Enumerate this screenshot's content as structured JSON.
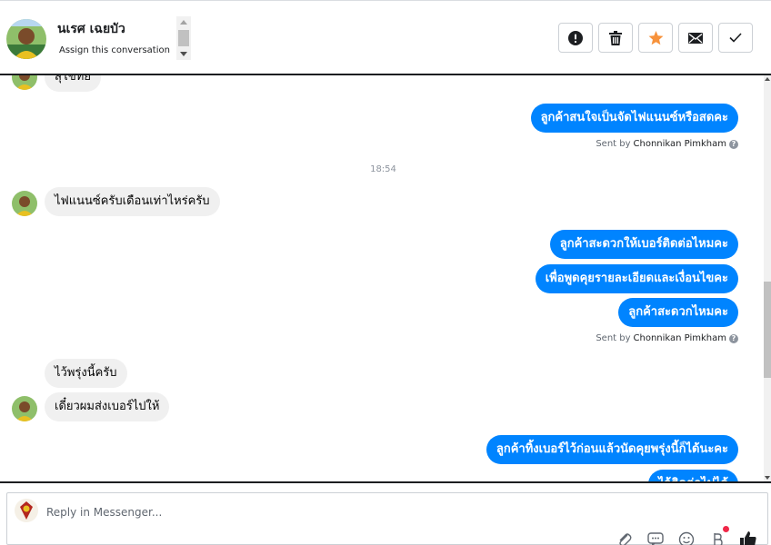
{
  "header": {
    "contact_name": "นเรศ เฉยบัว",
    "assign_label": "Assign this conversation",
    "actions": [
      {
        "name": "mark-spam-button",
        "icon": "exclamation-icon"
      },
      {
        "name": "delete-button",
        "icon": "trash-icon"
      },
      {
        "name": "star-button",
        "icon": "star-icon",
        "color": "#f7923b"
      },
      {
        "name": "mark-unread-button",
        "icon": "envelope-icon"
      },
      {
        "name": "mark-done-button",
        "icon": "check-icon"
      }
    ]
  },
  "conversation": {
    "messages": [
      {
        "dir": "in",
        "text": "สุโขทัย"
      },
      {
        "dir": "out",
        "text": "ลูกค้าสนใจเป็นจัดไฟแนนซ์หรือสดคะ"
      },
      {
        "type": "sent_by",
        "prefix": "Sent by",
        "name": "Chonnikan Pimkham"
      },
      {
        "type": "time",
        "text": "18:54"
      },
      {
        "dir": "in",
        "text": "ไฟแนนซ์ครับเดือนเท่าไหร่ครับ"
      },
      {
        "dir": "out",
        "text": "ลูกค้าสะดวกให้เบอร์ติดต่อไหมคะ"
      },
      {
        "dir": "out",
        "text": "เพื่อพูดคุยรายละเอียดและเงื่อนไขคะ"
      },
      {
        "dir": "out",
        "text": "ลูกค้าสะดวกไหมคะ"
      },
      {
        "type": "sent_by",
        "prefix": "Sent by",
        "name": "Chonnikan Pimkham"
      },
      {
        "dir": "in",
        "text": "ไว้พรุ่งนี้ครับ"
      },
      {
        "dir": "in",
        "text": "เดี๋ยวผมส่งเบอร์ไปให้"
      },
      {
        "dir": "out",
        "text": "ลูกค้าทิ้งเบอร์ไว้ก่อนแล้วนัดคุยพรุ่งนี้ก็ได้นะคะ"
      },
      {
        "dir": "out",
        "text": "ไว้ติดต่อไปได้"
      }
    ]
  },
  "composer": {
    "placeholder": "Reply in Messenger...",
    "tools": [
      "paperclip-icon",
      "saved-reply-icon",
      "emoji-icon",
      "currency-icon",
      "thumbs-up-icon"
    ]
  },
  "colors": {
    "outgoing_bubble": "#0084ff",
    "incoming_bubble": "#f0f0f0",
    "star_accent": "#f7923b"
  }
}
